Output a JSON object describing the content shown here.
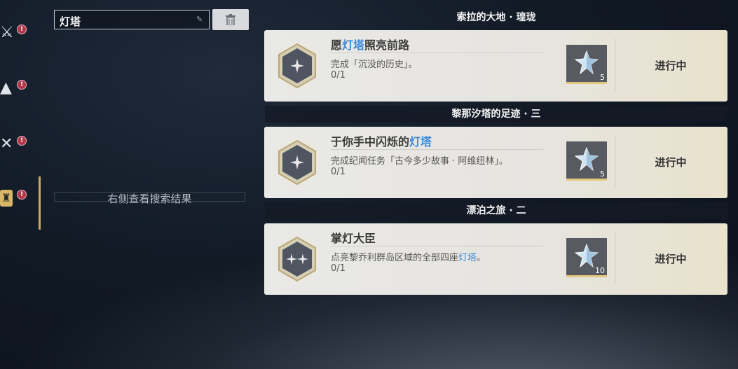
{
  "search": {
    "query": "灯塔",
    "empty_hint": "右侧查看搜索结果"
  },
  "rail": {
    "items": [
      {
        "icon": "sword-emblem-icon",
        "badge": "!"
      },
      {
        "icon": "mountain-emblem-icon",
        "badge": "!"
      },
      {
        "icon": "crossed-blades-icon",
        "badge": "!"
      },
      {
        "icon": "lighthouse-category-icon",
        "badge": "!"
      }
    ]
  },
  "results": [
    {
      "section": "索拉的大地 · 瑝珑",
      "title_parts": [
        "愿",
        "灯塔",
        "照亮前路"
      ],
      "desc_parts": [
        "完成「沉没的历史」。",
        "",
        ""
      ],
      "progress": "0/1",
      "reward_count": "5",
      "status": "进行中",
      "emblem": "single-star"
    },
    {
      "section": "黎那汐塔的足迹 · 三",
      "title_parts": [
        "于你手中闪烁的",
        "灯塔",
        ""
      ],
      "desc_parts": [
        "完成纪闻任务「古今多少故事 · 阿维纽林」。",
        "",
        ""
      ],
      "progress": "0/1",
      "reward_count": "5",
      "status": "进行中",
      "emblem": "single-star"
    },
    {
      "section": "漂泊之旅 · 二",
      "title_parts": [
        "掌灯大臣",
        "",
        ""
      ],
      "desc_parts": [
        "点亮黎乔利群岛区域的全部四座",
        "灯塔",
        "。"
      ],
      "progress": "0/1",
      "reward_count": "10",
      "status": "进行中",
      "emblem": "double-star"
    }
  ],
  "colors": {
    "highlight": "#3d8ad8",
    "gold": "#c9aa63",
    "badge": "#b1384a"
  }
}
